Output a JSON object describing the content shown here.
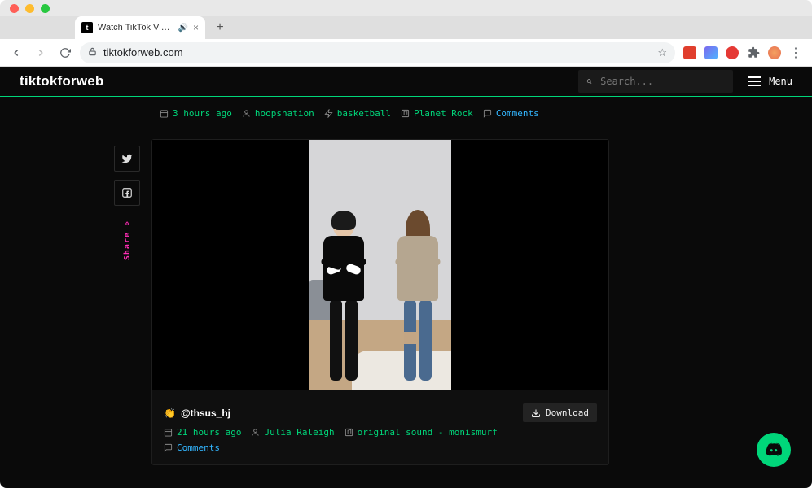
{
  "browser": {
    "tab_title": "Watch TikTok Videos Onlin",
    "url": "tiktokforweb.com"
  },
  "header": {
    "brand": "tiktokforweb",
    "search_placeholder": "Search...",
    "menu_label": "Menu"
  },
  "share": {
    "label": "Share »"
  },
  "prev_post": {
    "time": "3 hours ago",
    "author": "hoopsnation",
    "tag": "basketball",
    "sound": "Planet Rock",
    "comments_label": "Comments"
  },
  "post": {
    "emoji": "👏",
    "handle": "@thsus_hj",
    "download_label": "Download",
    "time": "21 hours ago",
    "author": "Julia Raleigh",
    "sound": "original sound - monismurf",
    "comments_label": "Comments"
  }
}
